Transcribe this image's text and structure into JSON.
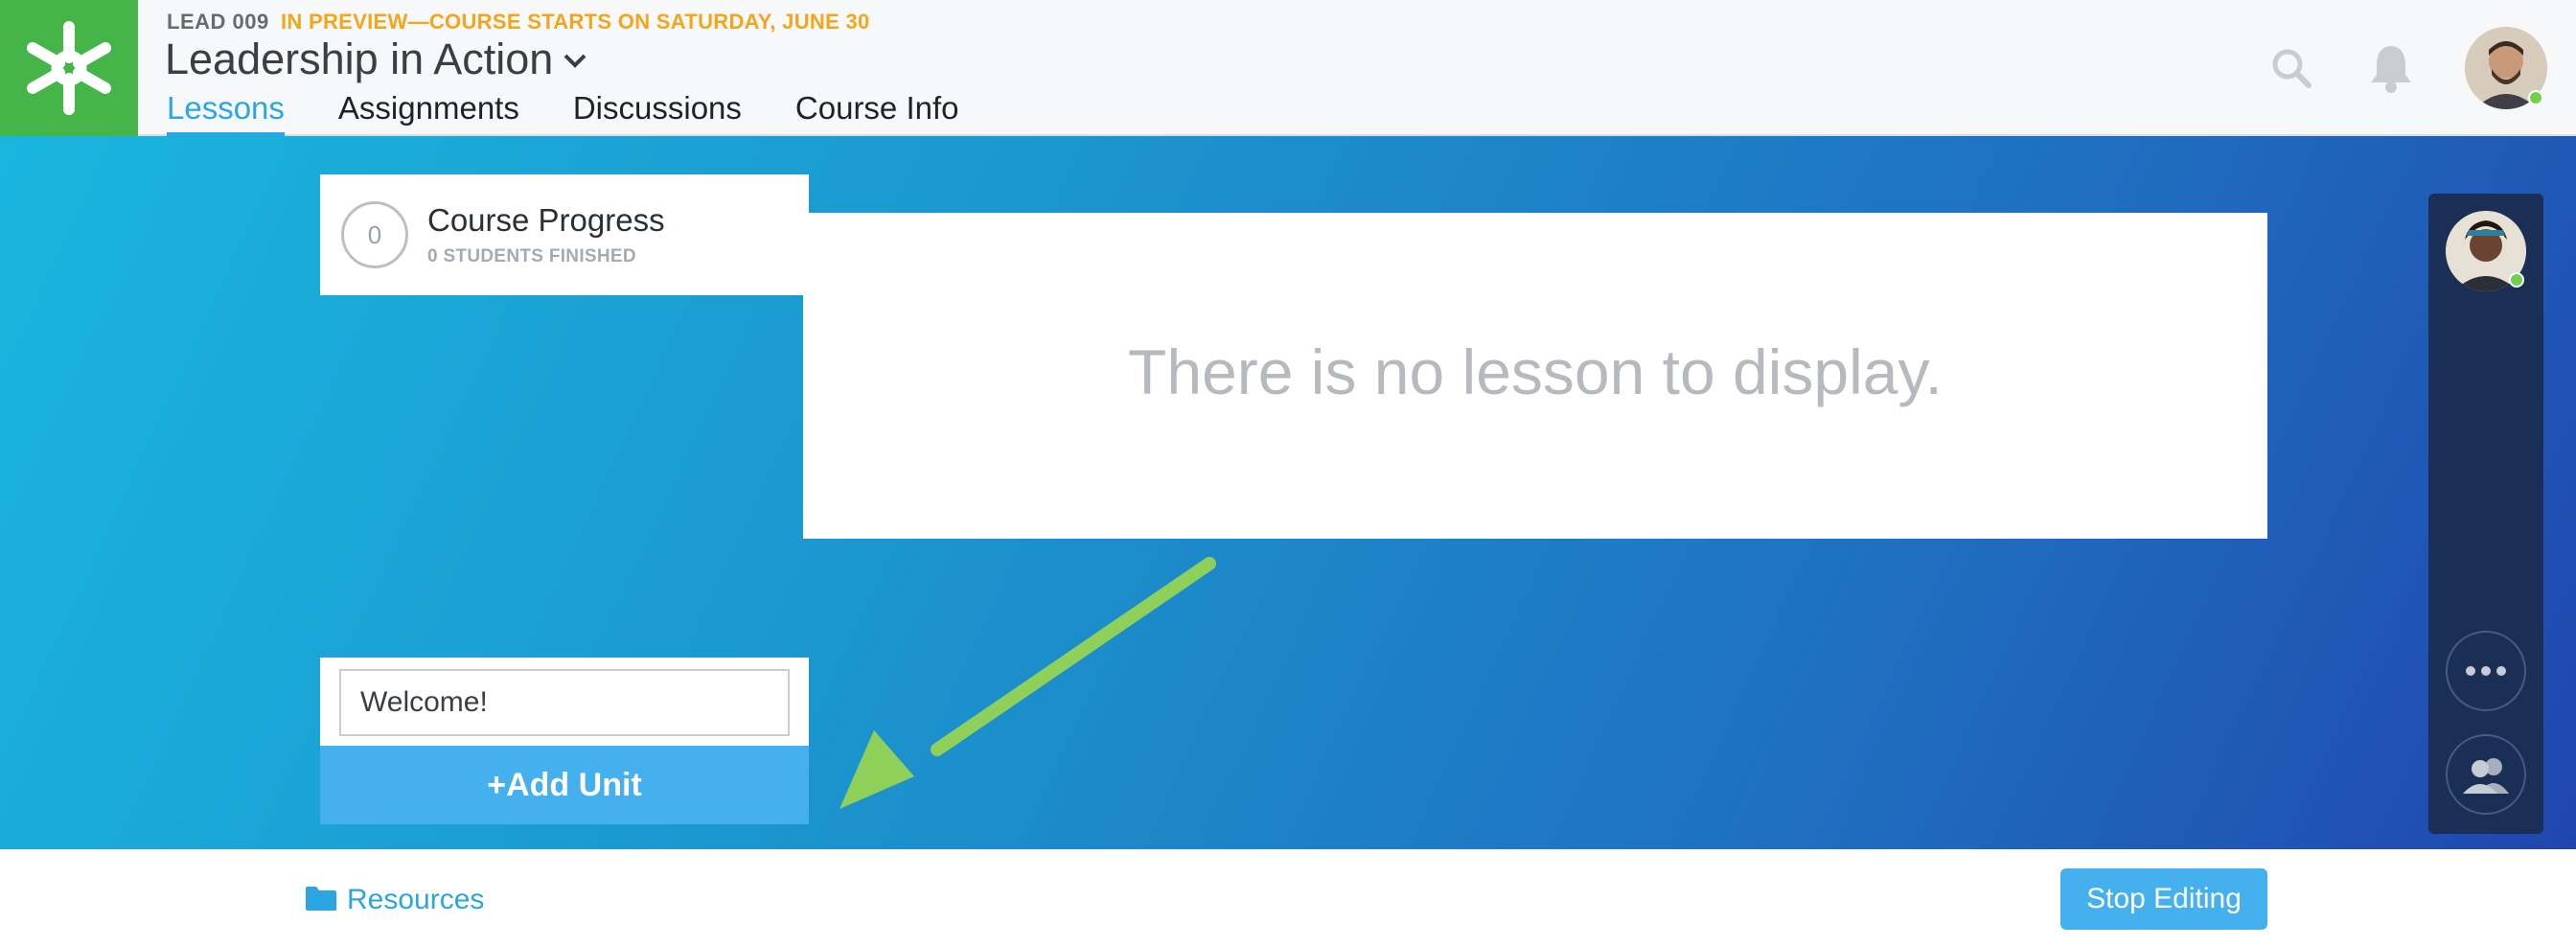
{
  "header": {
    "course_code": "LEAD 009",
    "preview_note": "IN PREVIEW—COURSE STARTS ON SATURDAY, JUNE 30",
    "course_title": "Leadership in Action",
    "tabs": [
      {
        "label": "Lessons",
        "active": true
      },
      {
        "label": "Assignments",
        "active": false
      },
      {
        "label": "Discussions",
        "active": false
      },
      {
        "label": "Course Info",
        "active": false
      }
    ],
    "icons": [
      "logo-star-icon",
      "search-icon",
      "bell-icon",
      "user-avatar"
    ]
  },
  "progress": {
    "count": "0",
    "title": "Course Progress",
    "subtitle": "0 STUDENTS FINISHED"
  },
  "lesson": {
    "empty_message": "There is no lesson to display."
  },
  "unit": {
    "input_value": "Welcome!",
    "add_button": "+Add Unit"
  },
  "side_rail": {
    "icons": [
      "instructor-avatar",
      "more-options-icon",
      "people-icon"
    ]
  },
  "footer": {
    "resources_label": "Resources",
    "stop_editing_label": "Stop Editing"
  },
  "colors": {
    "brand_green": "#45b549",
    "accent_blue": "#2aa6e3",
    "preview_orange": "#f5a51a",
    "annotation_arrow": "#8fd05a"
  }
}
